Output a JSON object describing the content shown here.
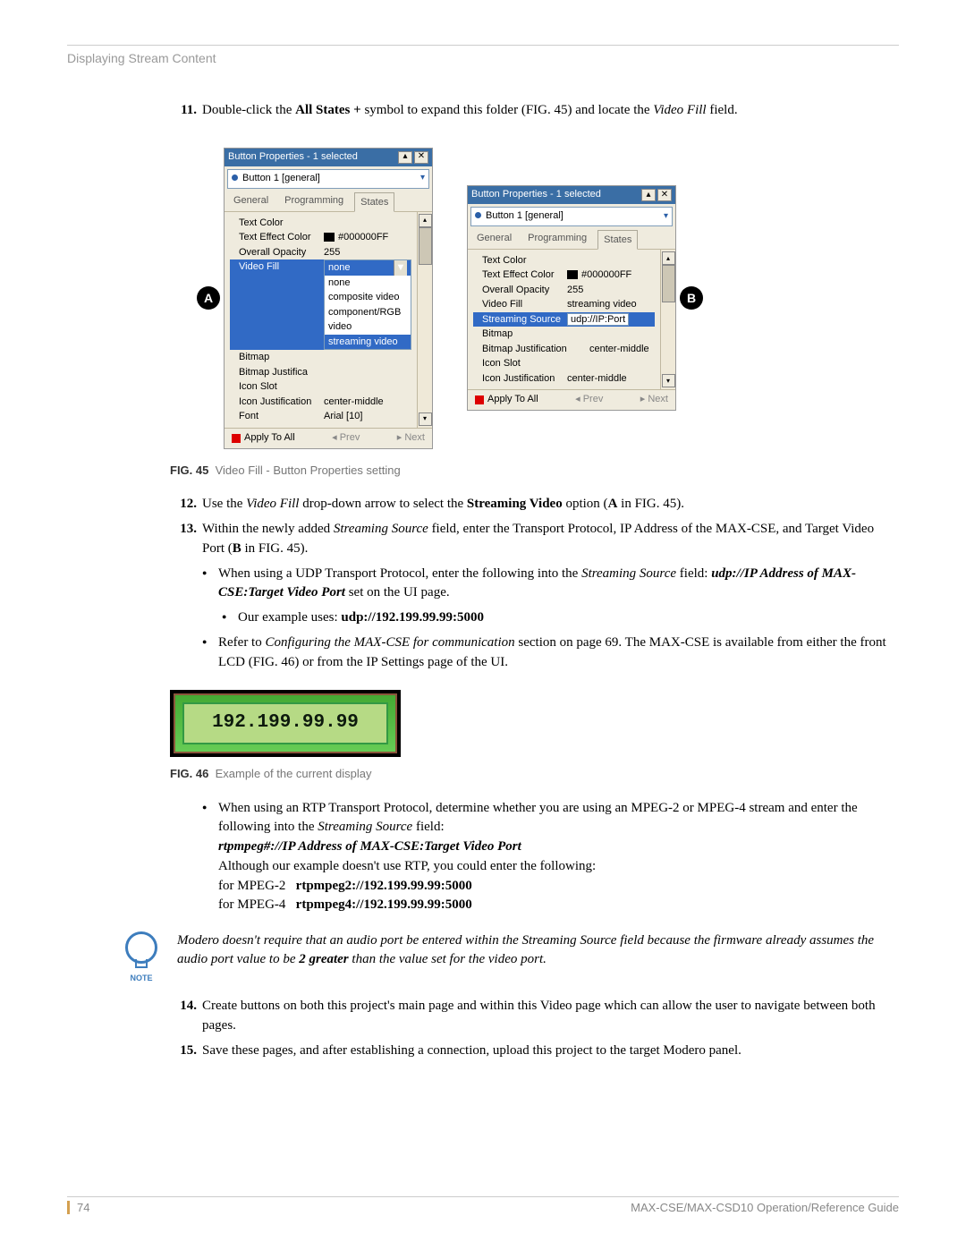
{
  "header": "Displaying Stream Content",
  "step11": {
    "num": "11.",
    "t1": "Double-click the ",
    "b1": "All States +",
    "t2": " symbol to expand this folder (FIG. 45) and locate the ",
    "i1": "Video Fill",
    "t3": " field."
  },
  "panelA": {
    "title": "Button Properties - 1 selected",
    "select": "Button 1  [general]",
    "tabs": {
      "general": "General",
      "prog": "Programming",
      "states": "States"
    },
    "props": {
      "textColor": "Text Color",
      "textEffectColor": "Text Effect Color",
      "textEffectVal": "#000000FF",
      "opacity": "Overall Opacity",
      "opacityVal": "255",
      "videoFill": "Video Fill",
      "videoFillSel": "none",
      "dd": {
        "none": "none",
        "composite": "composite video",
        "component": "component/RGB video",
        "streaming": "streaming video"
      },
      "bitmap": "Bitmap",
      "bitmapJust": "Bitmap Justifica",
      "iconSlot": "Icon Slot",
      "iconJust": "Icon Justification",
      "iconJustVal": "center-middle",
      "font": "Font",
      "fontVal": "Arial [10]"
    },
    "footer": {
      "apply": "Apply To All",
      "prev": "Prev",
      "next": "Next"
    }
  },
  "markerA": "A",
  "markerB": "B",
  "panelB": {
    "title": "Button Properties - 1 selected",
    "select": "Button 1  [general]",
    "tabs": {
      "general": "General",
      "prog": "Programming",
      "states": "States"
    },
    "props": {
      "textColor": "Text Color",
      "textEffectColor": "Text Effect Color",
      "textEffectVal": "#000000FF",
      "opacity": "Overall Opacity",
      "opacityVal": "255",
      "videoFill": "Video Fill",
      "videoFillVal": "streaming video",
      "streamSrc": "Streaming Source",
      "streamSrcVal": "udp://IP:Port",
      "bitmap": "Bitmap",
      "bitmapJust": "Bitmap Justification",
      "bitmapJustVal": "center-middle",
      "iconSlot": "Icon Slot",
      "iconJust": "Icon Justification",
      "iconJustVal": "center-middle"
    },
    "footer": {
      "apply": "Apply To All",
      "prev": "Prev",
      "next": "Next"
    }
  },
  "fig45": {
    "num": "FIG. 45",
    "text": "Video Fill - Button Properties setting"
  },
  "step12": {
    "num": "12.",
    "t1": "Use the ",
    "i1": "Video Fill",
    "t2": " drop-down arrow to select the ",
    "b1": "Streaming Video",
    "t3": " option (",
    "b2": "A",
    "t4": " in FIG. 45)."
  },
  "step13": {
    "num": "13.",
    "t1": "Within the newly added ",
    "i1": "Streaming Source",
    "t2": " field, enter the Transport Protocol, IP Address of the MAX-CSE, and Target Video Port (",
    "b1": "B",
    "t3": " in FIG. 45)."
  },
  "b1": {
    "t1": "When using a UDP Transport Protocol, enter the following into the ",
    "i1": "Streaming Source",
    "t2": " field: ",
    "bi1": "udp://IP Address of MAX-CSE:Target Video Port",
    "t3": " set on the UI page."
  },
  "b1a": {
    "t1": "Our example uses: ",
    "b1": "udp://192.199.99.99:5000"
  },
  "b2": {
    "t1": "Refer to ",
    "i1": "Configuring the MAX-CSE for communication",
    "t2": " section on page 69. The MAX-CSE is available from either the front LCD (FIG. 46) or from the IP Settings page of the UI."
  },
  "lcd": "192.199.99.99",
  "fig46": {
    "num": "FIG. 46",
    "text": "Example of the current display"
  },
  "b3": {
    "t1": "When using an RTP Transport Protocol, determine whether you are using an MPEG-2 or MPEG-4 stream and enter the following into the ",
    "i1": "Streaming Source",
    "t2": " field:",
    "bi1": "rtpmpeg#://IP Address of MAX-CSE:Target Video Port",
    "t3": "Although our example doesn't use RTP, you could enter the following:",
    "l1a": "for MPEG-2",
    "l1b": "rtpmpeg2://192.199.99.99:5000",
    "l2a": "for MPEG-4",
    "l2b": "rtpmpeg4://192.199.99.99:5000"
  },
  "note": {
    "label": "NOTE",
    "t1": "Modero doesn't require that an audio port be entered within the Streaming Source field because the firmware already assumes the audio port value to be ",
    "b1": "2 greater",
    "t2": " than the value set for the video port."
  },
  "step14": {
    "num": "14.",
    "t1": "Create buttons on both this project's main page and within this Video page which can allow the user to navigate between both pages."
  },
  "step15": {
    "num": "15.",
    "t1": "Save these pages, and after establishing a connection, upload this project to the target Modero panel."
  },
  "footer": {
    "page": "74",
    "guide": "MAX-CSE/MAX-CSD10 Operation/Reference Guide"
  }
}
